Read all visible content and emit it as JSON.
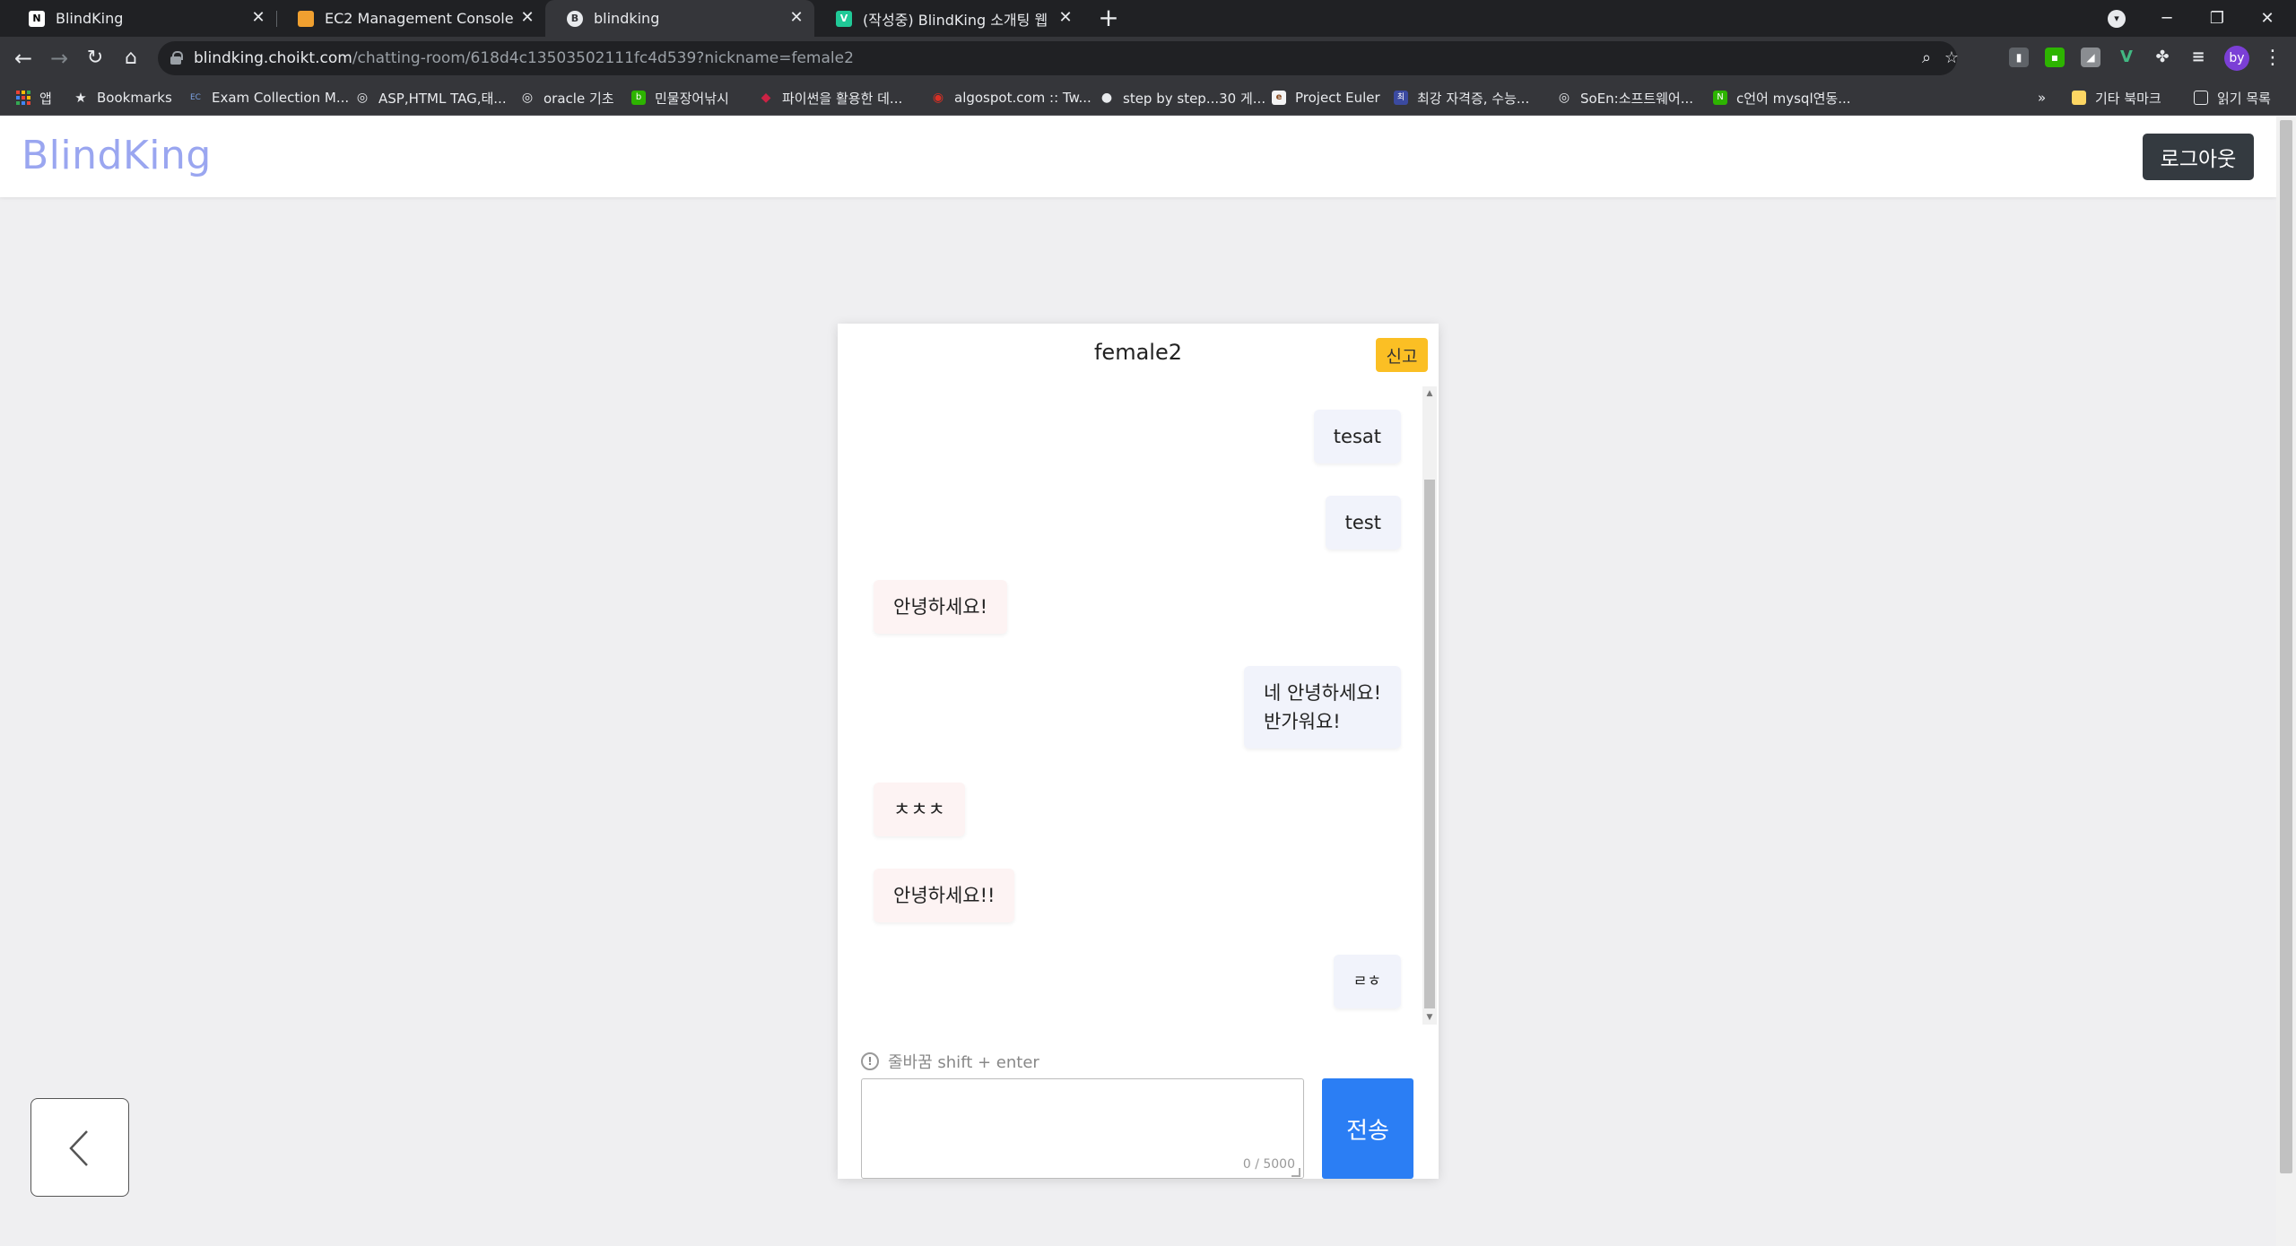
{
  "browser": {
    "tabs": [
      {
        "title": "BlindKing",
        "favicon": "N",
        "icon": "notion-icon",
        "color": "#ffffff"
      },
      {
        "title": "EC2 Management Console",
        "favicon": "",
        "icon": "aws-box-icon",
        "color": "#f0a030"
      },
      {
        "title": "blindking",
        "favicon": "B",
        "icon": "blindking-favicon-icon",
        "color": "#e8eaed"
      },
      {
        "title": "(작성중) BlindKing 소개팅 웹 소",
        "favicon": "V",
        "icon": "velog-icon",
        "color": "#20c997"
      }
    ],
    "url_host": "blindking.choikt.com",
    "url_path": "/chatting-room/618d4c13503502111fc4d539?nickname=female2",
    "profile_initials": "by",
    "bookmarks": [
      {
        "label": "앱",
        "icon": "apps-grid-icon"
      },
      {
        "label": "Bookmarks",
        "icon": "star-icon"
      },
      {
        "label": "Exam Collection M...",
        "icon": "ec-icon",
        "glyph": "EC",
        "color": "#3a5a9a"
      },
      {
        "label": "ASP,HTML TAG,태...",
        "icon": "globe-icon",
        "glyph": "◎",
        "color": "#5f6368"
      },
      {
        "label": "oracle 기초",
        "icon": "globe-icon",
        "glyph": "◎",
        "color": "#5f6368"
      },
      {
        "label": "민물장어낚시",
        "icon": "naver-blog-icon",
        "glyph": "b",
        "color": "#2db400"
      },
      {
        "label": "파이썬을 활용한 데...",
        "icon": "ruby-icon",
        "glyph": "◆",
        "color": "#cc2244"
      },
      {
        "label": "algospot.com :: Tw...",
        "icon": "algospot-icon",
        "glyph": "◉",
        "color": "#d93025"
      },
      {
        "label": "step by step...30 게...",
        "icon": "github-icon",
        "glyph": "●",
        "color": "#444444"
      },
      {
        "label": "Project Euler",
        "icon": "euler-icon",
        "glyph": "e",
        "color": "#f4f4f4"
      },
      {
        "label": "최강 자격증, 수능...",
        "icon": "site-icon",
        "glyph": "최",
        "color": "#3b4aa0"
      },
      {
        "label": "SoEn:소프트웨어...",
        "icon": "globe-icon",
        "glyph": "◎",
        "color": "#5f6368"
      },
      {
        "label": "c언어 mysql연동...",
        "icon": "naver-icon",
        "glyph": "N",
        "color": "#2db400"
      }
    ],
    "bookmarks_more": "»",
    "other_bookmarks": "기타 북마크",
    "reading_list": "읽기 목록"
  },
  "site": {
    "logo": "BlindKing",
    "logout_label": "로그아웃"
  },
  "chat": {
    "partner_nickname": "female2",
    "report_label": "신고",
    "messages": [
      {
        "text": "tesat",
        "mine": true
      },
      {
        "text": "test",
        "mine": true
      },
      {
        "text": "안녕하세요!",
        "mine": false
      },
      {
        "text": "네 안녕하세요!\n반가워요!",
        "mine": true
      },
      {
        "text": "ㅊㅊㅊ",
        "mine": false
      },
      {
        "text": "안녕하세요!!",
        "mine": false
      },
      {
        "text": "ㄹㅎ",
        "mine": true
      }
    ],
    "hint": "줄바꿈 shift + enter",
    "input_value": "",
    "counter": "0 / 5000",
    "send_label": "전송"
  },
  "colors": {
    "accent": "#2b7ef4",
    "report": "#fbbf24",
    "logo": "#9aa6f0",
    "logout": "#343a40",
    "mine_bubble": "#f1f3fb",
    "theirs_bubble": "#fdf3f3"
  }
}
